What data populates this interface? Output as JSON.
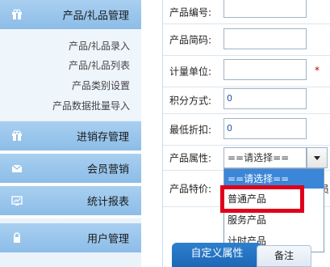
{
  "sidebar": {
    "sections": [
      {
        "label": "产品/礼品管理",
        "icon": "gift-icon"
      },
      {
        "label": "进销存管理",
        "icon": "gift-icon"
      },
      {
        "label": "会员营销",
        "icon": "mail-icon"
      },
      {
        "label": "统计报表",
        "icon": "chart-icon"
      },
      {
        "label": "用户管理",
        "icon": "lock-icon"
      }
    ],
    "sub_items": [
      "产品/礼品录入",
      "产品/礼品列表",
      "产品类别设置",
      "产品数据批量导入"
    ]
  },
  "form": {
    "fields": [
      {
        "label": "产品编号:",
        "value": ""
      },
      {
        "label": "产品简码:",
        "value": ""
      },
      {
        "label": "计量单位:",
        "value": ""
      },
      {
        "label": "积分方式:",
        "value": "0"
      },
      {
        "label": "最低折扣:",
        "value": "0"
      },
      {
        "label": "产品属性:",
        "value": ""
      },
      {
        "label": "产品特价:",
        "value": ""
      }
    ],
    "required_mark": "*",
    "attribute_select": {
      "selected": "==请选择==",
      "options": [
        "==请选择==",
        "普通产品",
        "服务产品",
        "计时产品"
      ],
      "highlighted_option": "普通产品"
    },
    "clipped_text": "员"
  },
  "tabs": [
    "自定义属性",
    "备注"
  ],
  "colors": {
    "accent": "#3b86d8",
    "highlight_border": "#e0001b",
    "sidebar_header": "#8cbde8"
  }
}
